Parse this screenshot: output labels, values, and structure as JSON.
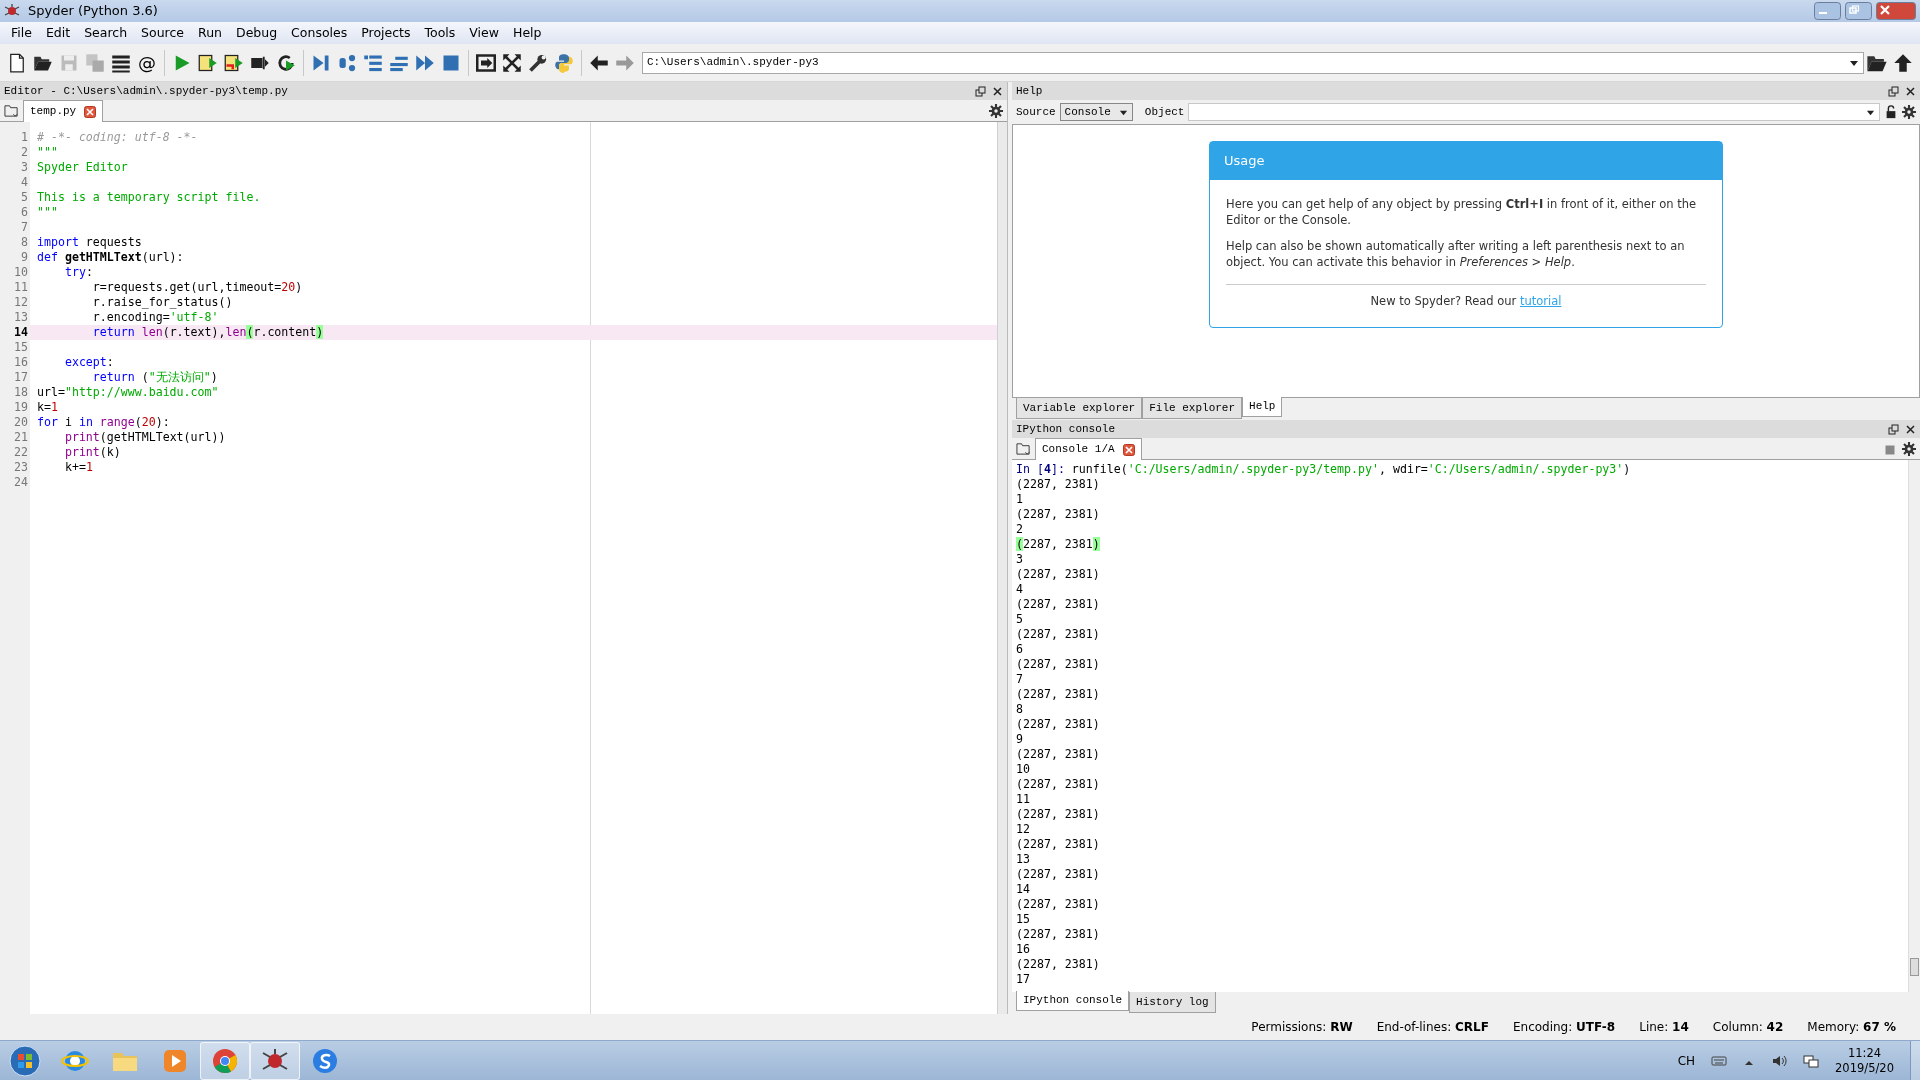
{
  "window": {
    "title": "Spyder (Python 3.6)"
  },
  "menu": [
    "File",
    "Edit",
    "Search",
    "Source",
    "Run",
    "Debug",
    "Consoles",
    "Projects",
    "Tools",
    "View",
    "Help"
  ],
  "toolbar": {
    "at_label": "@",
    "path": "C:\\Users\\admin\\.spyder-py3"
  },
  "editor": {
    "title": "Editor - C:\\Users\\admin\\.spyder-py3\\temp.py",
    "tabs": [
      {
        "label": "temp.py",
        "selected": true
      }
    ],
    "lines": [
      {
        "number": "1",
        "current": false,
        "tokens": [
          {
            "kind": "comment",
            "text": "# -*- coding: utf-8 -*-"
          }
        ]
      },
      {
        "number": "2",
        "current": false,
        "tokens": [
          {
            "kind": "string",
            "text": "\"\"\""
          }
        ]
      },
      {
        "number": "3",
        "current": false,
        "tokens": [
          {
            "kind": "string",
            "text": "Spyder Editor"
          }
        ]
      },
      {
        "number": "4",
        "current": false
      },
      {
        "number": "5",
        "current": false,
        "tokens": [
          {
            "kind": "string",
            "text": "This is a temporary script file."
          }
        ]
      },
      {
        "number": "6",
        "current": false,
        "tokens": [
          {
            "kind": "string",
            "text": "\"\"\""
          }
        ]
      },
      {
        "number": "7",
        "current": false
      },
      {
        "number": "8",
        "current": false,
        "tokens": [
          {
            "kind": "keyword",
            "text": "import"
          },
          {
            "kind": "plain",
            "text": " requests"
          }
        ]
      },
      {
        "number": "9",
        "current": false,
        "tokens": [
          {
            "kind": "keyword",
            "text": "def "
          },
          {
            "kind": "definition",
            "text": "getHTMLText"
          },
          {
            "kind": "plain",
            "text": "(url):"
          }
        ]
      },
      {
        "number": "10",
        "current": false,
        "tokens": [
          {
            "kind": "keyword",
            "text": "    try"
          },
          {
            "kind": "plain",
            "text": ":"
          }
        ]
      },
      {
        "number": "11",
        "current": false,
        "tokens": [
          {
            "kind": "plain",
            "text": "        r=requests.get(url,timeout="
          },
          {
            "kind": "number",
            "text": "20"
          },
          {
            "kind": "plain",
            "text": ")"
          }
        ]
      },
      {
        "number": "12",
        "current": false,
        "tokens": [
          {
            "kind": "plain",
            "text": "        r.raise_for_status()"
          }
        ]
      },
      {
        "number": "13",
        "current": false,
        "tokens": [
          {
            "kind": "plain",
            "text": "        r.encoding="
          },
          {
            "kind": "string",
            "text": "'utf-8'"
          }
        ]
      },
      {
        "number": "14",
        "current": true,
        "tokens": [
          {
            "kind": "keyword",
            "text": "        return "
          },
          {
            "kind": "builtin",
            "text": "len"
          },
          {
            "kind": "plain",
            "text": "(r.text),"
          },
          {
            "kind": "builtin",
            "text": "len"
          },
          {
            "kind": "match",
            "text": "("
          },
          {
            "kind": "plain",
            "text": "r.content"
          },
          {
            "kind": "match",
            "text": ")"
          }
        ]
      },
      {
        "number": "15",
        "current": false
      },
      {
        "number": "16",
        "current": false,
        "tokens": [
          {
            "kind": "keyword",
            "text": "    except"
          },
          {
            "kind": "plain",
            "text": ":"
          }
        ]
      },
      {
        "number": "17",
        "current": false,
        "tokens": [
          {
            "kind": "keyword",
            "text": "        return"
          },
          {
            "kind": "plain",
            "text": " ("
          },
          {
            "kind": "string",
            "text": "\"无法访问\""
          },
          {
            "kind": "plain",
            "text": ")"
          }
        ]
      },
      {
        "number": "18",
        "current": false,
        "tokens": [
          {
            "kind": "plain",
            "text": "url="
          },
          {
            "kind": "string",
            "text": "\"http://www.baidu.com\""
          }
        ]
      },
      {
        "number": "19",
        "current": false,
        "tokens": [
          {
            "kind": "plain",
            "text": "k="
          },
          {
            "kind": "number",
            "text": "1"
          }
        ]
      },
      {
        "number": "20",
        "current": false,
        "tokens": [
          {
            "kind": "keyword",
            "text": "for"
          },
          {
            "kind": "plain",
            "text": " i "
          },
          {
            "kind": "keyword",
            "text": "in "
          },
          {
            "kind": "builtin",
            "text": "range"
          },
          {
            "kind": "plain",
            "text": "("
          },
          {
            "kind": "number",
            "text": "20"
          },
          {
            "kind": "plain",
            "text": "):"
          }
        ]
      },
      {
        "number": "21",
        "current": false,
        "tokens": [
          {
            "kind": "builtin",
            "text": "    print"
          },
          {
            "kind": "plain",
            "text": "(getHTMLText(url))"
          }
        ]
      },
      {
        "number": "22",
        "current": false,
        "tokens": [
          {
            "kind": "builtin",
            "text": "    print"
          },
          {
            "kind": "plain",
            "text": "(k)"
          }
        ]
      },
      {
        "number": "23",
        "current": false,
        "tokens": [
          {
            "kind": "plain",
            "text": "    k+="
          },
          {
            "kind": "number",
            "text": "1"
          }
        ]
      },
      {
        "number": "24",
        "current": false
      }
    ]
  },
  "help": {
    "title": "Help",
    "source_label": "Source",
    "source_value": "Console",
    "object_label": "Object",
    "usage": {
      "heading": "Usage",
      "paragraphs": [
        "Here you can get help of any object by pressing **Ctrl+I** in front of it, either on the Editor or the Console.",
        "Help can also be shown automatically after writing a left parenthesis next to an object. You can activate this behavior in *Preferences > Help*."
      ],
      "footer": "New to Spyder? Read our",
      "link": "tutorial"
    },
    "tabs": [
      {
        "label": "Variable explorer",
        "selected": false
      },
      {
        "label": "File explorer",
        "selected": false
      },
      {
        "label": "Help",
        "selected": true
      }
    ]
  },
  "console": {
    "title": "IPython console",
    "tabs": [
      {
        "label": "Console 1/A",
        "selected": true
      }
    ],
    "lines": [
      {
        "tokens": [
          {
            "kind": "prompt",
            "text": "In ["
          },
          {
            "kind": "prompt-number",
            "text": "4"
          },
          {
            "kind": "prompt",
            "text": "]:"
          },
          {
            "kind": "plain",
            "text": " runfile("
          },
          {
            "kind": "string",
            "text": "'C:/Users/admin/.spyder-py3/temp.py'"
          },
          {
            "kind": "plain",
            "text": ", wdir="
          },
          {
            "kind": "string",
            "text": "'C:/Users/admin/.spyder-py3'"
          },
          {
            "kind": "plain",
            "text": ")"
          }
        ]
      },
      {
        "text": "(2287, 2381)"
      },
      {
        "text": "1"
      },
      {
        "text": "(2287, 2381)"
      },
      {
        "text": "2"
      },
      {
        "tokens": [
          {
            "kind": "match",
            "text": "("
          },
          {
            "kind": "plain",
            "text": "2287, 2381"
          },
          {
            "kind": "match",
            "text": ")"
          }
        ]
      },
      {
        "text": "3"
      },
      {
        "text": "(2287, 2381)"
      },
      {
        "text": "4"
      },
      {
        "text": "(2287, 2381)"
      },
      {
        "text": "5"
      },
      {
        "text": "(2287, 2381)"
      },
      {
        "text": "6"
      },
      {
        "text": "(2287, 2381)"
      },
      {
        "text": "7"
      },
      {
        "text": "(2287, 2381)"
      },
      {
        "text": "8"
      },
      {
        "text": "(2287, 2381)"
      },
      {
        "text": "9"
      },
      {
        "text": "(2287, 2381)"
      },
      {
        "text": "10"
      },
      {
        "text": "(2287, 2381)"
      },
      {
        "text": "11"
      },
      {
        "text": "(2287, 2381)"
      },
      {
        "text": "12"
      },
      {
        "text": "(2287, 2381)"
      },
      {
        "text": "13"
      },
      {
        "text": "(2287, 2381)"
      },
      {
        "text": "14"
      },
      {
        "text": "(2287, 2381)"
      },
      {
        "text": "15"
      },
      {
        "text": "(2287, 2381)"
      },
      {
        "text": "16"
      },
      {
        "text": "(2287, 2381)"
      },
      {
        "text": "17"
      }
    ],
    "bottom_tabs": [
      {
        "label": "IPython console",
        "selected": true
      },
      {
        "label": "History log",
        "selected": false
      }
    ]
  },
  "status_bar": [
    {
      "label": "Permissions:",
      "value": "RW"
    },
    {
      "label": "End-of-lines:",
      "value": "CRLF"
    },
    {
      "label": "Encoding:",
      "value": "UTF-8"
    },
    {
      "label": "Line:",
      "value": "14"
    },
    {
      "label": "Column:",
      "value": "42"
    },
    {
      "label": "Memory:",
      "value": "67 %"
    }
  ],
  "taskbar": {
    "language": "CH",
    "time": "11:24",
    "date": "2019/5/20"
  }
}
